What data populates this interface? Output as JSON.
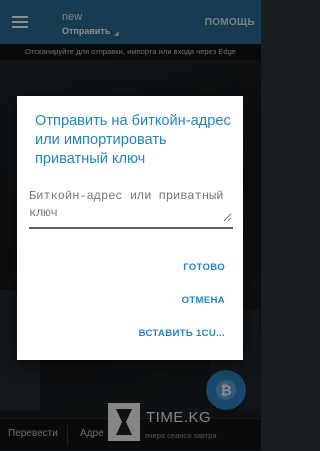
{
  "header": {
    "wallet_name": "new",
    "mode": "Отправить",
    "help": "ПОМОЩЬ"
  },
  "scan_hint": "Отсканируйте для отправки, импорта или входа через Edge",
  "dialog": {
    "title": "Отправить на биткойн-адрес или импортировать приватный ключ",
    "input_placeholder": "Биткойн-адрес или приватный ключ",
    "done": "ГОТОВО",
    "cancel": "ОТМЕНА",
    "paste": "ВСТАВИТЬ 1CU..."
  },
  "bottom_nav": {
    "transfer": "Перевести",
    "address": "Адре",
    "sync_status": "вчера сеанса завтра"
  },
  "watermark": "TIME.KG",
  "colors": {
    "appbar": "#2a6e96",
    "accent": "#1f86c4",
    "fab": "#2f86c2"
  },
  "icons": [
    "menu-icon",
    "chevron-down-icon",
    "bitcoin-icon",
    "hourglass-icon"
  ]
}
